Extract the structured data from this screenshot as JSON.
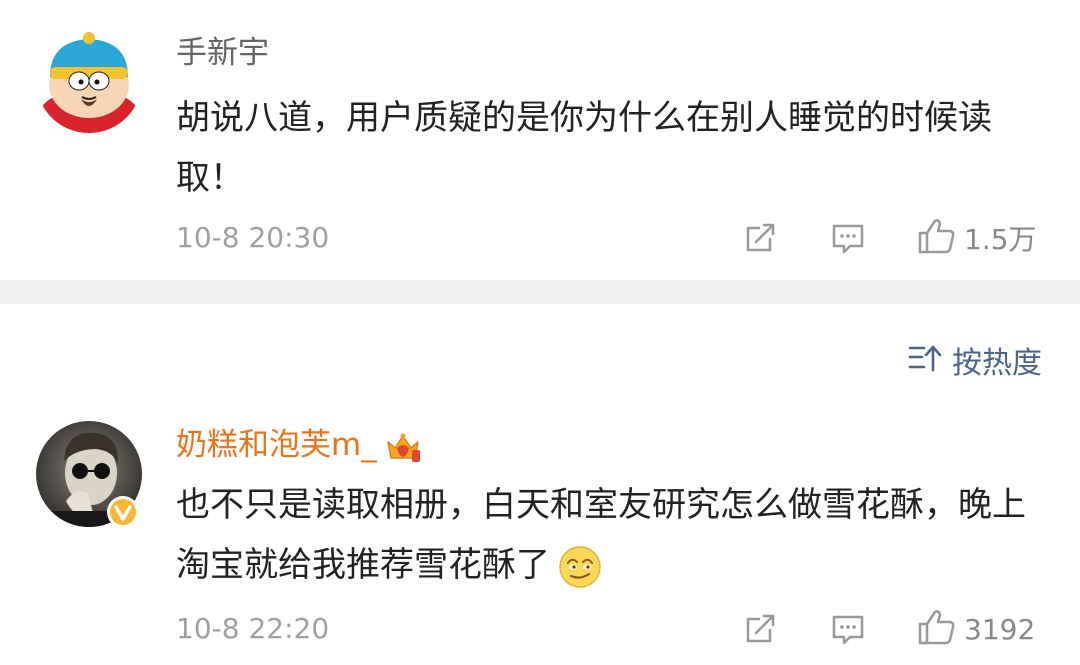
{
  "comments": [
    {
      "username": "手新宇",
      "content": "胡说八道，用户质疑的是你为什么在别人睡觉的时候读取！",
      "timestamp": "10-8 20:30",
      "like_count": "1.5万",
      "avatar_icon": "cartman-avatar-icon"
    },
    {
      "username": "奶糕和泡芙m_",
      "content": "也不只是读取相册，白天和室友研究怎么做雪花酥，晚上淘宝就给我推荐雪花酥了",
      "timestamp": "10-8 22:20",
      "like_count": "3192",
      "avatar_icon": "photo-avatar-icon",
      "badge_icon": "crown-badge-icon",
      "verified_icon": "verified-v-icon",
      "trailing_emoji": "smirk-emoji-icon"
    }
  ],
  "sort": {
    "label": "按热度",
    "icon": "sort-icon"
  },
  "colors": {
    "username_default": "#666666",
    "username_vip": "#e8741c",
    "sort_label": "#4d6486",
    "meta_gray": "#a0a0a0",
    "separator": "#f0f0f0"
  }
}
